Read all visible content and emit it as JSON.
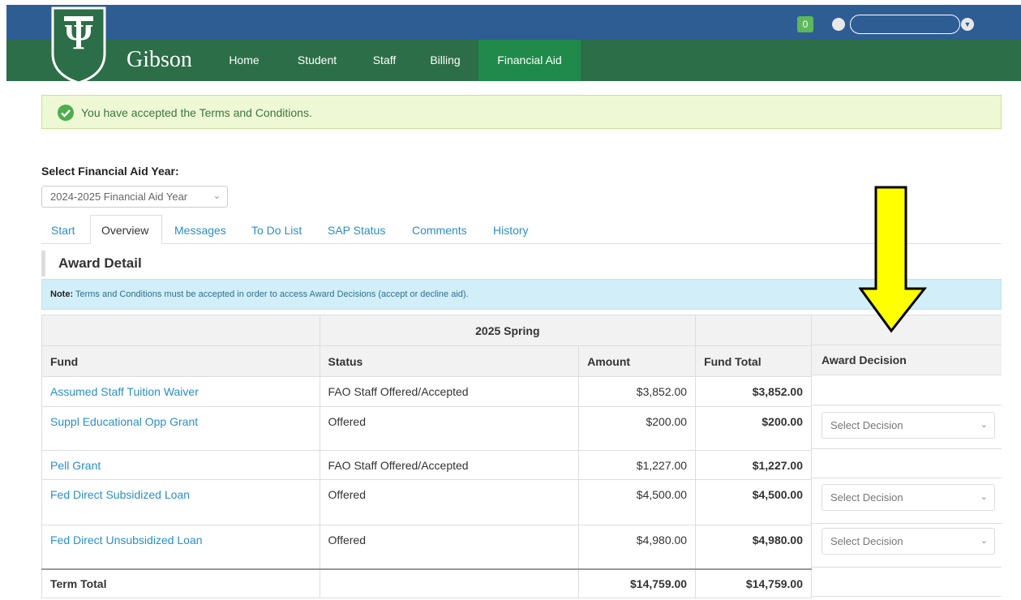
{
  "header": {
    "brand": "Gibson",
    "nav": [
      "Home",
      "Student",
      "Staff",
      "Billing",
      "Financial Aid"
    ],
    "active_nav": "Financial Aid",
    "notification_count": "0",
    "colors": {
      "topbar": "#2e5d94",
      "navbar": "#2c6e47",
      "active": "#1f8a4a"
    }
  },
  "alert": {
    "message": "You have accepted the Terms and Conditions."
  },
  "year": {
    "label": "Select Financial Aid Year:",
    "selected": "2024-2025 Financial Aid Year"
  },
  "tabs": [
    "Start",
    "Overview",
    "Messages",
    "To Do List",
    "SAP Status",
    "Comments",
    "History"
  ],
  "active_tab": "Overview",
  "section_title": "Award Detail",
  "note": {
    "prefix": "Note:",
    "text": " Terms and Conditions must be accepted in order to access Award Decisions (accept or decline aid)."
  },
  "table": {
    "term_header": "2025 Spring",
    "columns": [
      "Fund",
      "Status",
      "Amount",
      "Fund Total",
      "Award Decision"
    ],
    "rows": [
      {
        "fund": "Assumed Staff Tuition Waiver",
        "status": "FAO Staff Offered/Accepted",
        "amount": "$3,852.00",
        "total": "$3,852.00",
        "decision": ""
      },
      {
        "fund": "Suppl Educational Opp Grant",
        "status": "Offered",
        "amount": "$200.00",
        "total": "$200.00",
        "decision": "Select Decision"
      },
      {
        "fund": "Pell Grant",
        "status": "FAO Staff Offered/Accepted",
        "amount": "$1,227.00",
        "total": "$1,227.00",
        "decision": ""
      },
      {
        "fund": "Fed Direct Subsidized Loan",
        "status": "Offered",
        "amount": "$4,500.00",
        "total": "$4,500.00",
        "decision": "Select Decision"
      },
      {
        "fund": "Fed Direct Unsubsidized Loan",
        "status": "Offered",
        "amount": "$4,980.00",
        "total": "$4,980.00",
        "decision": "Select Decision"
      }
    ],
    "total_row": {
      "label": "Term Total",
      "amount": "$14,759.00",
      "total": "$14,759.00"
    }
  }
}
